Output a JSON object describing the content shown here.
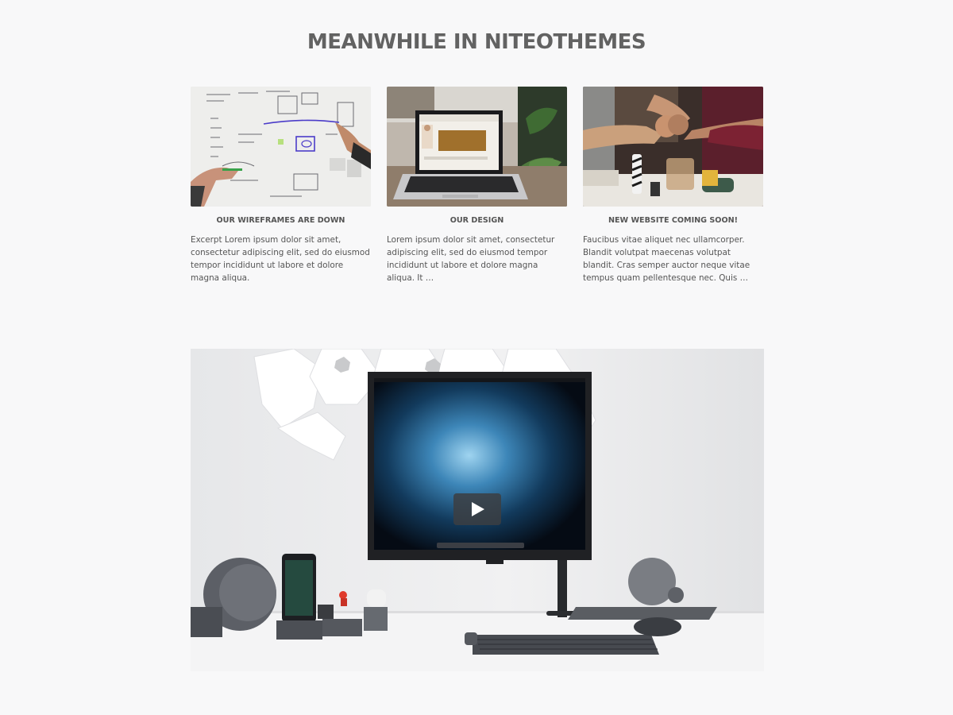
{
  "section": {
    "title": "MEANWHILE IN NITEOTHEMES"
  },
  "posts": [
    {
      "title": "OUR WIREFRAMES ARE DOWN",
      "excerpt": "Excerpt Lorem ipsum dolor sit amet, consectetur adipiscing elit, sed do eiusmod tempor incididunt ut labore et dolore magna aliqua.",
      "image": "whiteboard-sketch-photo"
    },
    {
      "title": "OUR DESIGN",
      "excerpt": "Lorem ipsum dolor sit amet, consectetur adipiscing elit, sed do eiusmod tempor incididunt ut labore et dolore magna aliqua. It …",
      "image": "laptop-on-desk-photo"
    },
    {
      "title": "NEW WEBSITE COMING SOON!",
      "excerpt": "Faucibus vitae aliquet nec ullamcorper. Blandit volutpat maecenas volutpat blandit. Cras semper auctor neque vitae tempus quam pellentesque nec. Quis …",
      "image": "team-fist-bump-photo"
    }
  ],
  "video": {
    "poster": "desk-setup-monitor-photo",
    "play_icon": "play-icon"
  },
  "colors": {
    "background": "#f8f8f9",
    "title": "#626262",
    "text": "#555555",
    "play_button": "#3c3e42"
  }
}
